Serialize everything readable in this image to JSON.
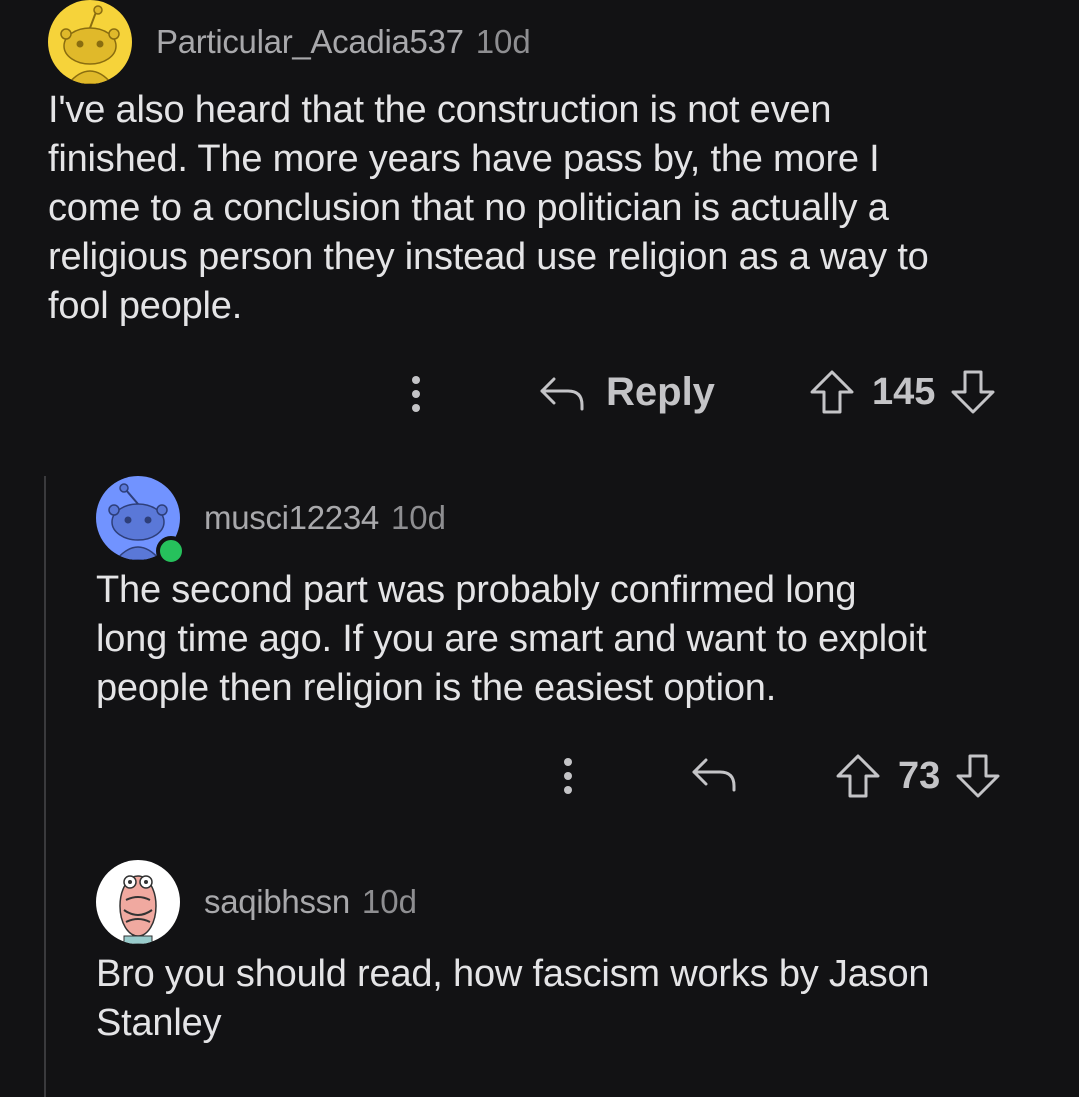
{
  "comments": [
    {
      "username": "Particular_Acadia537",
      "age": "10d",
      "avatar_color": "#f6d33a",
      "text": "I've also heard that the construction is not even\nfinished. The more years have pass by, the more I\ncome to a conclusion that no politician is actually a\nreligious person they instead use religion as a way to\nfool people.",
      "reply_label": "Reply",
      "score": "145"
    },
    {
      "username": "musci12234",
      "age": "10d",
      "avatar_color": "#7193ff",
      "online": true,
      "text": "The second part was probably confirmed long\nlong time ago. If you are smart and want to exploit\npeople then religion is the easiest option.",
      "score": "73"
    },
    {
      "username": "saqibhssn",
      "age": "10d",
      "avatar_color": "#ffffff",
      "text": "Bro you should read, how fascism works by Jason\nStanley"
    }
  ],
  "icons": {
    "more": "more-options-icon",
    "reply": "reply-arrow-icon",
    "upvote": "upvote-arrow-icon",
    "downvote": "downvote-arrow-icon"
  },
  "colors": {
    "background": "#121214",
    "text": "#e4e4e6",
    "meta": "#a8a8ab",
    "online": "#26c15c"
  }
}
